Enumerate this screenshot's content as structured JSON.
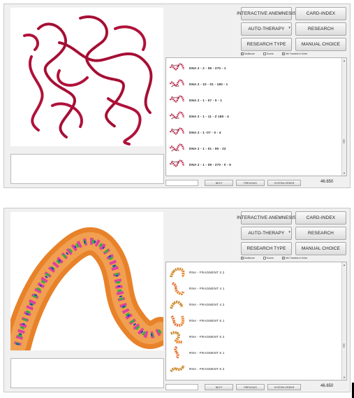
{
  "buttons": {
    "interactive_anamnesis": "INTERACTIVE ANEMNESIS",
    "card_index": "CARD-INDEX",
    "auto_therapy": "AUTO-THERAPY",
    "research": "RESEARCH",
    "research_type": "RESEARCH TYPE",
    "manual_choice": "MANUAL CHOICE"
  },
  "checks": {
    "c1": "Multizone",
    "c2": "Scene",
    "c3": "4th Transform Order"
  },
  "panel1": {
    "items": [
      {
        "label": "DNA 2 - 2 - 06 - 270 - 1"
      },
      {
        "label": "DNA 2 - 10 - 01 - 180 - 1"
      },
      {
        "label": "DNA 2 - 1 - 07 - 0 - 1"
      },
      {
        "label": "DNA 2 - 1 - 11 - Z 180 - 4"
      },
      {
        "label": "DNA 2 - 1 -07 - 0 - 4"
      },
      {
        "label": "DNA 2 - 1 - 01 - 90 - 22"
      },
      {
        "label": "DNA 2 - 1 - 09 - 270 - 0 - 5"
      }
    ],
    "value": "46.650"
  },
  "panel2": {
    "items": [
      {
        "label": "RNA - FRAGMENT 3 2"
      },
      {
        "label": "RNA - FRAGMENT 4 1"
      },
      {
        "label": "RNA - FRAGMENT 4 2"
      },
      {
        "label": "RNA - FRAGMENT 5 1"
      },
      {
        "label": "RNA - FRAGMENT 5 2"
      },
      {
        "label": "RNA - FRAGMENT 6 1"
      },
      {
        "label": "RNA - FRAGMENT 6 2"
      }
    ],
    "value": "46.650"
  },
  "bottom": {
    "next": "NEXT",
    "previous": "PREVIOUS",
    "system_order": "SYSTEM ORDER"
  },
  "colors": {
    "dna": "#b0123a",
    "rna_orange": "#e8822a",
    "panel_bg": "#f0f0f0"
  }
}
